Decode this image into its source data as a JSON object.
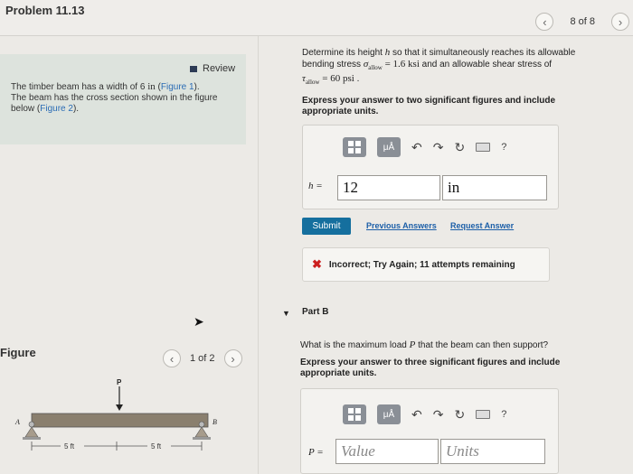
{
  "header": {
    "title": "Problem 11.13",
    "nav_count": "8 of 8",
    "prev_icon": "chevron-left-icon",
    "next_icon": "chevron-right-icon"
  },
  "left": {
    "review_label": "Review",
    "problem_text": {
      "part1": "The timber beam has a width of 6 ",
      "unit": "in",
      "part2": " (",
      "fig1_link": "Figure 1",
      "part3": ").",
      "part4": "The beam has the cross section shown in the figure below (",
      "fig2_link": "Figure 2",
      "part5": ")."
    },
    "figure_label": "Figure",
    "figure_nav": "1 of 2",
    "diagram": {
      "load_label": "P",
      "support_a": "A",
      "support_b": "B",
      "dim1": "5 ft",
      "dim2": "5 ft"
    }
  },
  "partA": {
    "question_line1": "Determine its height ",
    "var_h": "h",
    "question_line1b": " so that it simultaneously reaches its allowable",
    "question_line2a": "bending stress ",
    "sigma": "σ",
    "sigma_sub": "allow",
    "sigma_val": " = 1.6 ksi",
    "question_line2b": " and an allowable shear stress of",
    "tau": "τ",
    "tau_sub": "allow",
    "tau_val": " = 60 psi",
    "question_end": " .",
    "instructions": "Express your answer to two significant figures and include appropriate units.",
    "toolbar": {
      "template_icon": "template-icon",
      "units_label": "μÅ",
      "undo": "↶",
      "redo": "↷",
      "reset": "↻",
      "keyboard_icon": "keyboard-icon",
      "help": "?"
    },
    "var_label": "h =",
    "value": "12",
    "units": "in",
    "submit": "Submit",
    "previous_answers": "Previous Answers",
    "request_answer": "Request Answer",
    "feedback": "Incorrect; Try Again; 11 attempts remaining"
  },
  "partB": {
    "label": "Part B",
    "question_a": "What is the maximum load ",
    "var_p": "P",
    "question_b": " that the beam can then support?",
    "instructions": "Express your answer to three significant figures and include appropriate units.",
    "var_label": "P =",
    "value_placeholder": "Value",
    "units_placeholder": "Units"
  }
}
